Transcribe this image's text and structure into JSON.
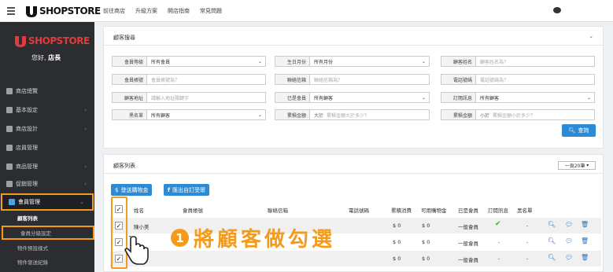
{
  "brand": {
    "logo_text": "SHOPSTORE"
  },
  "topnav": [
    "前往商店",
    "升級方案",
    "開店指南",
    "常見問題"
  ],
  "sidebar": {
    "hello_prefix": "您好,",
    "hello_name": "店長",
    "items": [
      {
        "label": "商店總覽"
      },
      {
        "label": "基本設定"
      },
      {
        "label": "商店設計"
      },
      {
        "label": "店員管理"
      },
      {
        "label": "商品管理"
      },
      {
        "label": "促銷管理"
      },
      {
        "label": "會員管理"
      }
    ],
    "subitems": [
      "顧客列表",
      "會員分級設定",
      "物件預設樣式",
      "物件發送紀錄"
    ]
  },
  "search_panel": {
    "title": "顧客搜尋",
    "fields": [
      {
        "label": "會員等級",
        "value": "所有會員",
        "select": true
      },
      {
        "label": "生日月份",
        "value": "所有月份",
        "select": true
      },
      {
        "label": "顧客姓名",
        "placeholder": "顧客姓名為？"
      },
      {
        "label": "會員帳號",
        "placeholder": "會員帳號為？"
      },
      {
        "label": "聯絡信箱",
        "placeholder": "聯絡信箱為？"
      },
      {
        "label": "電話號碼",
        "placeholder": "電話號碼為？"
      },
      {
        "label": "顧客地址",
        "placeholder": "請輸入地址關鍵字"
      },
      {
        "label": "已是會員",
        "value": "所有顧客",
        "select": true
      },
      {
        "label": "訂閱訊息",
        "value": "所有顧客",
        "select": true
      },
      {
        "label": "黑名單",
        "value": "所有顧客",
        "select": true
      },
      {
        "label": "累積金額",
        "prefix": "大於",
        "placeholder": "累積金額大於多少？"
      },
      {
        "label": "累積金額",
        "prefix": "小於",
        "placeholder": "累積金額小於多少？"
      }
    ],
    "query_button": "查詢"
  },
  "list_panel": {
    "title": "顧客列表",
    "per_page": "一頁20筆",
    "actions": [
      "發送購物金",
      "匯出自訂受眾"
    ],
    "columns": [
      "姓名",
      "會員帳號",
      "聯絡信箱",
      "電話號碼",
      "累積消費",
      "可用購物金",
      "已是會員",
      "訂閱訊息",
      "黑名單"
    ],
    "rows": [
      {
        "name": "陳小美",
        "spent": "$ 0",
        "credit": "$ 0",
        "member": "一般會員",
        "subscribed": true,
        "blacklist": "-"
      },
      {
        "name": "",
        "spent": "$ 0",
        "credit": "$ 0",
        "member": "一般會員",
        "subscribed": false,
        "blacklist": "-"
      },
      {
        "name": "",
        "spent": "$ 0",
        "credit": "$ 0",
        "member": "一般會員",
        "subscribed": false,
        "blacklist": "-"
      }
    ]
  },
  "callout": {
    "number": "1",
    "text": "將顧客做勾選"
  },
  "colors": {
    "accent": "#f59b1b",
    "primary": "#2d8bd6",
    "sidebar": "#2b2d31"
  }
}
